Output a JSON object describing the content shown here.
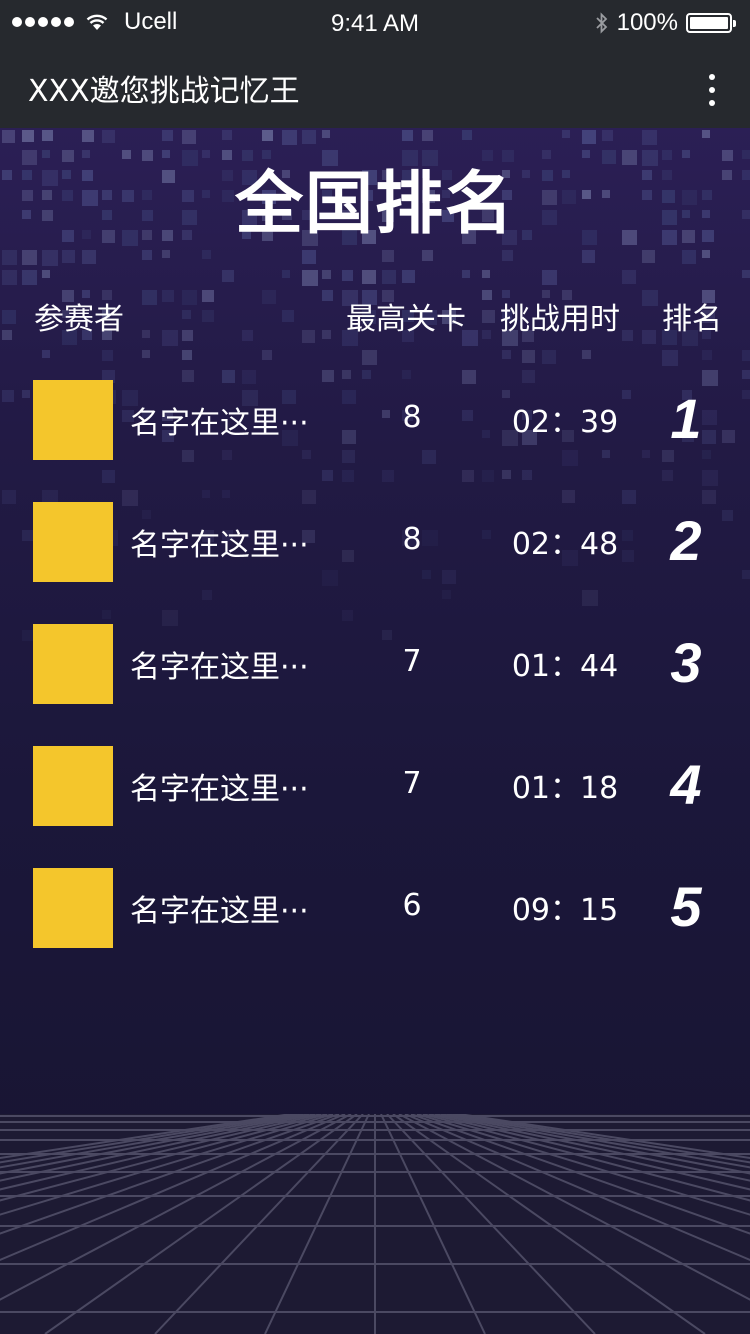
{
  "status_bar": {
    "carrier": "Ucell",
    "time": "9:41 AM",
    "battery": "100%",
    "battery_level": 1.0,
    "signal_icon": "signal-dots-icon",
    "wifi_icon": "wifi-icon",
    "bluetooth_icon": "bluetooth-icon"
  },
  "nav": {
    "title": "XXX邀您挑战记忆王",
    "more_icon": "more-vertical-icon"
  },
  "page": {
    "title": "全国排名",
    "headers": {
      "player": "参赛者",
      "level": "最高关卡",
      "time": "挑战用时",
      "rank": "排名"
    }
  },
  "ranking": [
    {
      "name": "名字在这里···",
      "level": "8",
      "time": "02：39",
      "rank": "1"
    },
    {
      "name": "名字在这里···",
      "level": "8",
      "time": "02：48",
      "rank": "2"
    },
    {
      "name": "名字在这里···",
      "level": "7",
      "time": "01：44",
      "rank": "3"
    },
    {
      "name": "名字在这里···",
      "level": "7",
      "time": "01：18",
      "rank": "4"
    },
    {
      "name": "名字在这里···",
      "level": "6",
      "time": "09：15",
      "rank": "5"
    }
  ],
  "colors": {
    "avatar": "#f4c62c",
    "bar": "#26292e",
    "background": "#1b173a"
  }
}
